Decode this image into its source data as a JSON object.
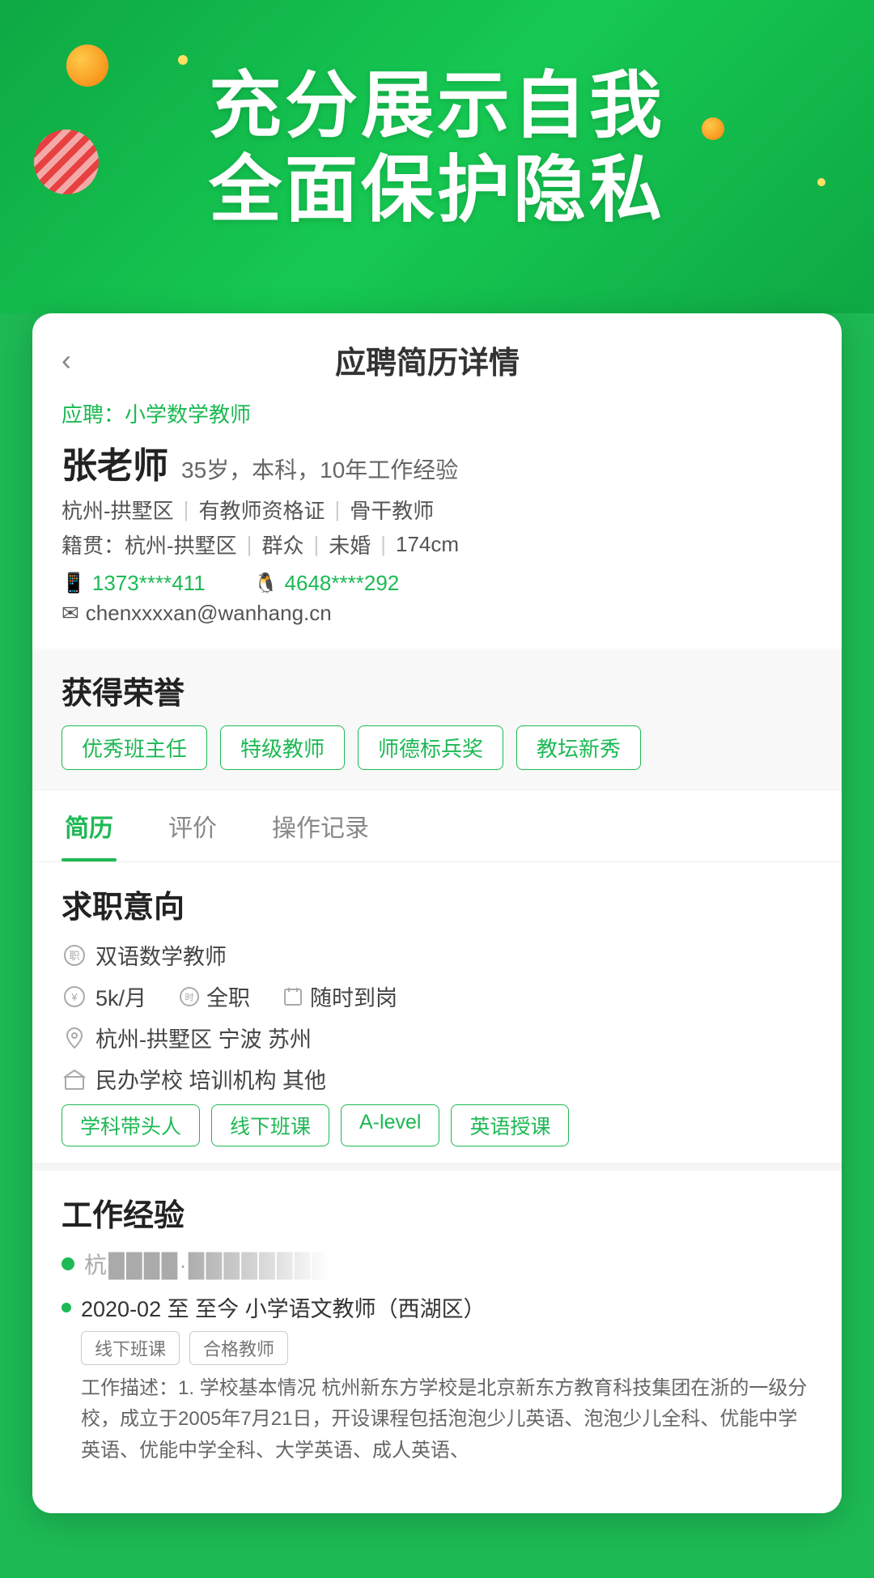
{
  "hero": {
    "line1": "充分展示自我",
    "line2": "全面保护隐私"
  },
  "card": {
    "back_label": "‹",
    "title": "应聘简历详情",
    "apply_label": "应聘：小学数学教师",
    "teacher_name": "张老师",
    "teacher_meta": "35岁，本科，10年工作经验",
    "location_info": "杭州-拱墅区",
    "qualification": "有教师资格证",
    "position_type": "骨干教师",
    "native_place": "籍贯：杭州-拱墅区",
    "political": "群众",
    "marital": "未婚",
    "height": "174cm",
    "phone": "1373****411",
    "qq": "4648****292",
    "email": "chenxxxxan@wanhang.cn",
    "honors_title": "获得荣誉",
    "honors": [
      "优秀班主任",
      "特级教师",
      "师德标兵奖",
      "教坛新秀"
    ],
    "tabs": [
      "简历",
      "评价",
      "操作记录"
    ],
    "active_tab": "简历",
    "job_intention_title": "求职意向",
    "job_title": "双语数学教师",
    "salary": "5k/月",
    "job_type": "全职",
    "availability": "随时到岗",
    "cities": "杭州-拱墅区  宁波  苏州",
    "school_types": "民办学校   培训机构   其他",
    "job_tags": [
      "学科带头人",
      "线下班课",
      "A-level",
      "英语授课"
    ],
    "work_exp_title": "工作经验",
    "company_name": "杭████·████████",
    "work_period": "2020-02 至 至今 小学语文教师（西湖区）",
    "work_small_tags": [
      "线下班课",
      "合格教师"
    ],
    "work_desc": "工作描述：1. 学校基本情况 杭州新东方学校是北京新东方教育科技集团在浙的一级分校，成立于2005年7月21日，开设课程包括泡泡少儿英语、泡泡少儿全科、优能中学英语、优能中学全科、大学英语、成人英语、"
  }
}
